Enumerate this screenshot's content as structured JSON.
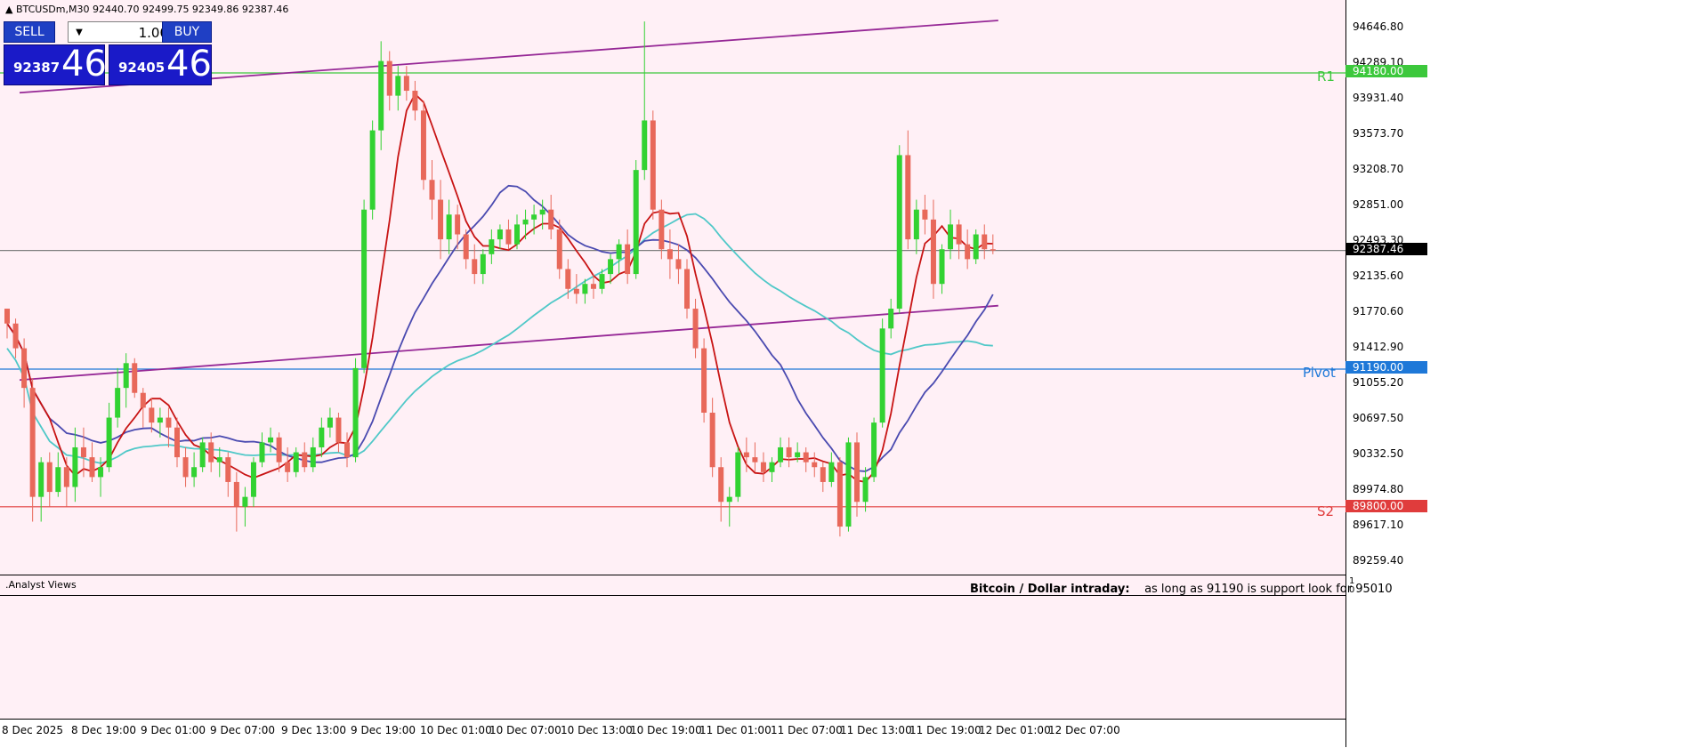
{
  "window": {
    "title": "BTCUSDm,M30  92440.70 92499.75 92349.86 92387.46"
  },
  "trade_panel": {
    "sell_label": "SELL",
    "buy_label": "BUY",
    "lot_value": "1.00",
    "sell_price_small": "92387",
    "sell_price_big": "46",
    "buy_price_small": "92405",
    "buy_price_big": "46"
  },
  "levels": {
    "r1": {
      "label": "R1",
      "price_tag": "94180.00",
      "color": "#3cc83c"
    },
    "pivot": {
      "label": "Pivot",
      "price_tag": "91190.00",
      "color": "#1e78d8"
    },
    "s2": {
      "label": "S2",
      "price_tag": "89800.00",
      "color": "#e03c3c"
    },
    "current_price_tag": "92387.46"
  },
  "price_axis": {
    "labels": [
      "94646.80",
      "94289.10",
      "93931.40",
      "93573.70",
      "93208.70",
      "92851.00",
      "92493.30",
      "92135.60",
      "91770.60",
      "91412.90",
      "91055.20",
      "90697.50",
      "90332.50",
      "89974.80",
      "89617.10",
      "89259.40"
    ]
  },
  "time_axis": {
    "labels": [
      "8 Dec 2025",
      "8 Dec 19:00",
      "9 Dec 01:00",
      "9 Dec 07:00",
      "9 Dec 13:00",
      "9 Dec 19:00",
      "10 Dec 01:00",
      "10 Dec 07:00",
      "10 Dec 13:00",
      "10 Dec 19:00",
      "11 Dec 01:00",
      "11 Dec 07:00",
      "11 Dec 13:00",
      "11 Dec 19:00",
      "12 Dec 01:00",
      "12 Dec 07:00"
    ]
  },
  "indicator_panel": {
    "name": ".Analyst Views",
    "axis_top": "1",
    "axis_bottom": "0"
  },
  "commentary": {
    "title": "Bitcoin / Dollar intraday:",
    "text": "as long as 91190 is support look for 95010"
  },
  "colors": {
    "bull": "#32d232",
    "bear": "#e8685a",
    "ma_fast": "#c81414",
    "ma_mid": "#4a4ab0",
    "ma_slow": "#50c8c8",
    "channel": "#962896",
    "current_line": "#808080"
  },
  "chart_data": {
    "type": "candlestick",
    "symbol": "BTCUSDm",
    "timeframe": "M30",
    "y_ticks": [
      94646.8,
      94289.1,
      93931.4,
      93573.7,
      93208.7,
      92851.0,
      92493.3,
      92135.6,
      91770.6,
      91412.9,
      91055.2,
      90697.5,
      90332.5,
      89974.8,
      89617.1,
      89259.4
    ],
    "last_price": 92387.46,
    "r1": 94180.0,
    "pivot": 91190.0,
    "s2": 89800.0,
    "trend_upper": [
      {
        "x": "8 Dec 2025",
        "y": 93980
      },
      {
        "x": "12 Dec 07:00",
        "y": 94710
      }
    ],
    "trend_lower": [
      {
        "x": "8 Dec 2025",
        "y": 91080
      },
      {
        "x": "12 Dec 07:00",
        "y": 91830
      }
    ],
    "candles": [
      [
        91800,
        91800,
        91500,
        91650
      ],
      [
        91650,
        91700,
        91300,
        91400
      ],
      [
        91400,
        91500,
        90800,
        91000
      ],
      [
        91000,
        91100,
        89650,
        89900
      ],
      [
        89900,
        90300,
        89650,
        90250
      ],
      [
        90250,
        90350,
        89800,
        89950
      ],
      [
        89950,
        90350,
        89900,
        90200
      ],
      [
        90200,
        90300,
        89800,
        90000
      ],
      [
        90000,
        90600,
        89850,
        90400
      ],
      [
        90400,
        90600,
        90100,
        90300
      ],
      [
        90300,
        90450,
        90050,
        90100
      ],
      [
        90100,
        90300,
        89900,
        90200
      ],
      [
        90200,
        90850,
        90150,
        90700
      ],
      [
        90700,
        91200,
        90600,
        91000
      ],
      [
        91000,
        91350,
        90800,
        91250
      ],
      [
        91250,
        91300,
        90900,
        90950
      ],
      [
        90950,
        91000,
        90600,
        90800
      ],
      [
        90800,
        90900,
        90550,
        90650
      ],
      [
        90650,
        90800,
        90500,
        90700
      ],
      [
        90700,
        90800,
        90400,
        90600
      ],
      [
        90600,
        90700,
        90200,
        90300
      ],
      [
        90300,
        90400,
        90000,
        90100
      ],
      [
        90100,
        90350,
        90000,
        90200
      ],
      [
        90200,
        90500,
        90150,
        90450
      ],
      [
        90450,
        90550,
        90150,
        90250
      ],
      [
        90250,
        90400,
        90100,
        90300
      ],
      [
        90300,
        90350,
        89900,
        90050
      ],
      [
        90050,
        90150,
        89550,
        89800
      ],
      [
        89800,
        90000,
        89600,
        89900
      ],
      [
        89900,
        90300,
        89800,
        90250
      ],
      [
        90250,
        90550,
        90200,
        90450
      ],
      [
        90450,
        90600,
        90350,
        90500
      ],
      [
        90500,
        90550,
        90150,
        90250
      ],
      [
        90250,
        90400,
        90050,
        90150
      ],
      [
        90150,
        90400,
        90100,
        90350
      ],
      [
        90350,
        90450,
        90150,
        90200
      ],
      [
        90200,
        90500,
        90150,
        90400
      ],
      [
        90400,
        90700,
        90300,
        90600
      ],
      [
        90600,
        90800,
        90500,
        90700
      ],
      [
        90700,
        90750,
        90350,
        90450
      ],
      [
        90450,
        90550,
        90200,
        90300
      ],
      [
        90300,
        91300,
        90250,
        91200
      ],
      [
        91200,
        92900,
        91150,
        92800
      ],
      [
        92800,
        93700,
        92700,
        93600
      ],
      [
        93600,
        94500,
        93400,
        94300
      ],
      [
        94300,
        94400,
        93800,
        93950
      ],
      [
        93950,
        94250,
        93800,
        94150
      ],
      [
        94150,
        94250,
        93900,
        94000
      ],
      [
        94000,
        94100,
        93700,
        93800
      ],
      [
        93800,
        93900,
        93000,
        93100
      ],
      [
        93100,
        93300,
        92700,
        92900
      ],
      [
        92900,
        93100,
        92300,
        92500
      ],
      [
        92500,
        92900,
        92350,
        92750
      ],
      [
        92750,
        92850,
        92400,
        92550
      ],
      [
        92550,
        92600,
        92200,
        92300
      ],
      [
        92300,
        92450,
        92050,
        92150
      ],
      [
        92150,
        92400,
        92050,
        92350
      ],
      [
        92350,
        92600,
        92250,
        92500
      ],
      [
        92500,
        92650,
        92400,
        92600
      ],
      [
        92600,
        92700,
        92400,
        92450
      ],
      [
        92450,
        92750,
        92400,
        92650
      ],
      [
        92650,
        92800,
        92500,
        92700
      ],
      [
        92700,
        92850,
        92550,
        92750
      ],
      [
        92750,
        92900,
        92600,
        92800
      ],
      [
        92800,
        92950,
        92500,
        92600
      ],
      [
        92600,
        92700,
        92100,
        92200
      ],
      [
        92200,
        92300,
        91900,
        92000
      ],
      [
        92000,
        92150,
        91850,
        91950
      ],
      [
        91950,
        92100,
        91850,
        92050
      ],
      [
        92050,
        92150,
        91900,
        92000
      ],
      [
        92000,
        92200,
        91950,
        92150
      ],
      [
        92150,
        92350,
        92050,
        92300
      ],
      [
        92300,
        92500,
        92150,
        92450
      ],
      [
        92450,
        92600,
        92050,
        92150
      ],
      [
        92150,
        93300,
        92100,
        93200
      ],
      [
        93200,
        94700,
        93100,
        93700
      ],
      [
        93700,
        93800,
        92700,
        92800
      ],
      [
        92800,
        92900,
        92300,
        92400
      ],
      [
        92400,
        92600,
        92100,
        92300
      ],
      [
        92300,
        92450,
        92050,
        92200
      ],
      [
        92200,
        92300,
        91700,
        91800
      ],
      [
        91800,
        91900,
        91300,
        91400
      ],
      [
        91400,
        91500,
        90650,
        90750
      ],
      [
        90750,
        90900,
        90100,
        90200
      ],
      [
        90200,
        90300,
        89650,
        89850
      ],
      [
        89850,
        90000,
        89600,
        89900
      ],
      [
        89900,
        90400,
        89850,
        90350
      ],
      [
        90350,
        90500,
        90150,
        90300
      ],
      [
        90300,
        90450,
        90150,
        90250
      ],
      [
        90250,
        90350,
        90050,
        90150
      ],
      [
        90150,
        90300,
        90050,
        90250
      ],
      [
        90250,
        90500,
        90200,
        90400
      ],
      [
        90400,
        90500,
        90200,
        90300
      ],
      [
        90300,
        90450,
        90250,
        90350
      ],
      [
        90350,
        90400,
        90150,
        90250
      ],
      [
        90250,
        90350,
        90100,
        90200
      ],
      [
        90200,
        90250,
        89950,
        90050
      ],
      [
        90050,
        90350,
        90000,
        90250
      ],
      [
        90250,
        90300,
        89500,
        89600
      ],
      [
        89600,
        90500,
        89550,
        90450
      ],
      [
        90450,
        90550,
        89700,
        89850
      ],
      [
        89850,
        90200,
        89750,
        90100
      ],
      [
        90100,
        90700,
        90050,
        90650
      ],
      [
        90650,
        91700,
        90600,
        91600
      ],
      [
        91600,
        91900,
        91500,
        91800
      ],
      [
        91800,
        93450,
        91750,
        93350
      ],
      [
        93350,
        93600,
        92400,
        92500
      ],
      [
        92500,
        92900,
        92350,
        92800
      ],
      [
        92800,
        92950,
        92550,
        92700
      ],
      [
        92700,
        92900,
        91900,
        92050
      ],
      [
        92050,
        92450,
        91950,
        92400
      ],
      [
        92400,
        92800,
        92300,
        92650
      ],
      [
        92650,
        92700,
        92300,
        92450
      ],
      [
        92450,
        92600,
        92200,
        92300
      ],
      [
        92300,
        92600,
        92250,
        92550
      ],
      [
        92550,
        92650,
        92300,
        92400
      ],
      [
        92400,
        92550,
        92350,
        92387
      ]
    ]
  }
}
